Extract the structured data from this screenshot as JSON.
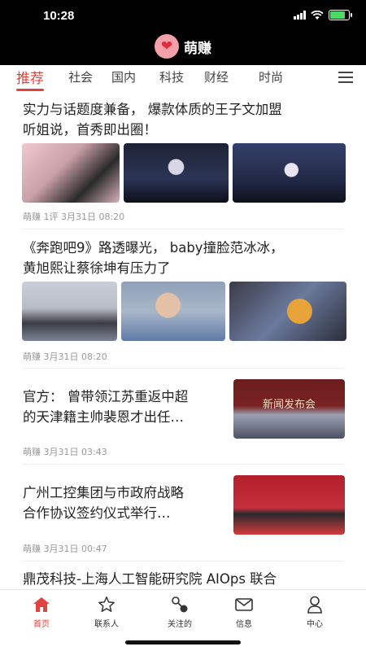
{
  "status": {
    "time": "10:28"
  },
  "brand": {
    "name": "萌赚"
  },
  "tabs": [
    "推荐",
    "社会",
    "国内",
    "科技",
    "财经",
    "时尚"
  ],
  "articles": [
    {
      "title_line1": "实力与话题度兼备，  爆款体质的王子文加盟",
      "title_line2": "听姐说，首秀即出圈！",
      "meta": "萌赚  1评  3月31日 08:20"
    },
    {
      "title_line1": "《奔跑吧9》路透曝光，  baby撞脸范冰冰，",
      "title_line2": "黄旭熙让蔡徐坤有压力了",
      "meta": "萌赚  3月31日 08:20"
    },
    {
      "title_line1": "官方：  曾带领江苏重返中超",
      "title_line2": "的天津籍主帅裴恩才出任…",
      "meta": "萌赚  3月31日 03:43",
      "image_caption": "新闻发布会"
    },
    {
      "title_line1": "广州工控集团与市政府战略",
      "title_line2": "合作协议签约仪式举行…",
      "meta": "萌赚  3月31日 00:47"
    },
    {
      "title_line1": "鼎茂科技-上海人工智能研究院 AIOps 联合"
    }
  ],
  "bottom_nav": [
    "首页",
    "联系人",
    "关注的",
    "信息",
    "中心"
  ],
  "colors": {
    "accent": "#e0443c",
    "header_bg": "#000000"
  }
}
